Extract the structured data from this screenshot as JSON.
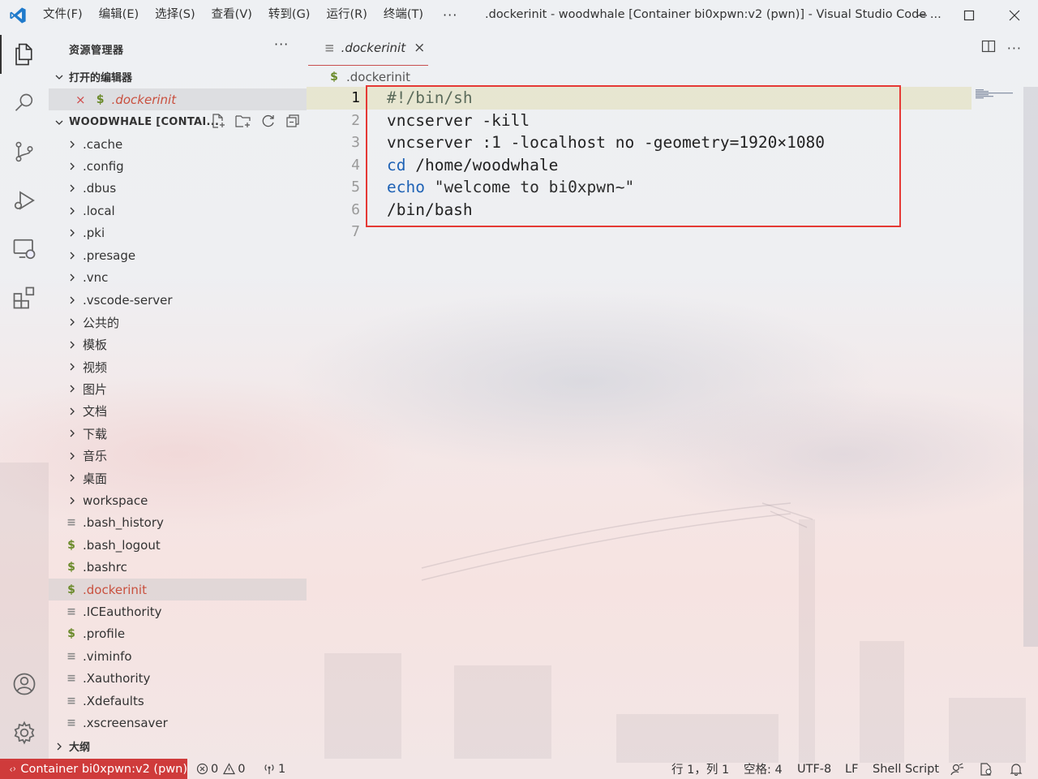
{
  "window": {
    "title": ".dockerinit - woodwhale [Container bi0xpwn:v2 (pwn)] - Visual Studio Code ...",
    "menu": [
      "文件(F)",
      "编辑(E)",
      "选择(S)",
      "查看(V)",
      "转到(G)",
      "运行(R)",
      "终端(T)"
    ],
    "menu_more": "···"
  },
  "activity_bar": {
    "items": [
      "files-icon",
      "search-icon",
      "source-control-icon",
      "run-debug-icon",
      "remote-explorer-icon",
      "extensions-icon"
    ],
    "bottom": [
      "account-icon",
      "settings-gear-icon"
    ]
  },
  "explorer": {
    "title": "资源管理器",
    "more": "···",
    "open_editors": {
      "header": "打开的编辑器",
      "items": [
        {
          "name": ".dockerinit",
          "icon": "$",
          "close": "×"
        }
      ]
    },
    "workspace": {
      "header": "WOODWHALE [CONTAI...",
      "folders": [
        ".cache",
        ".config",
        ".dbus",
        ".local",
        ".pki",
        ".presage",
        ".vnc",
        ".vscode-server",
        "公共的",
        "模板",
        "视频",
        "图片",
        "文档",
        "下载",
        "音乐",
        "桌面",
        "workspace"
      ],
      "files": [
        {
          "name": ".bash_history",
          "icon": "≡"
        },
        {
          "name": ".bash_logout",
          "icon": "$"
        },
        {
          "name": ".bashrc",
          "icon": "$"
        },
        {
          "name": ".dockerinit",
          "icon": "$"
        },
        {
          "name": ".ICEauthority",
          "icon": "≡"
        },
        {
          "name": ".profile",
          "icon": "$"
        },
        {
          "name": ".viminfo",
          "icon": "≡"
        },
        {
          "name": ".Xauthority",
          "icon": "≡"
        },
        {
          "name": ".Xdefaults",
          "icon": "≡"
        },
        {
          "name": ".xscreensaver",
          "icon": "≡"
        }
      ]
    },
    "outline_header": "大纲"
  },
  "editor": {
    "tab_label": ".dockerinit",
    "tab_icon": "≡",
    "tab_close": "×",
    "breadcrumb": ".dockerinit",
    "breadcrumb_icon": "$",
    "lines": [
      {
        "n": "1",
        "text": "#!/bin/sh"
      },
      {
        "n": "2",
        "text": "vncserver -kill"
      },
      {
        "n": "3",
        "text": "vncserver :1 -localhost no -geometry=1920×1080"
      },
      {
        "n": "4",
        "kw": "cd",
        "text": " /home/woodwhale"
      },
      {
        "n": "5",
        "kw": "echo",
        "text": " \"welcome to bi0xpwn~\""
      },
      {
        "n": "6",
        "text": "/bin/bash"
      },
      {
        "n": "7",
        "text": ""
      }
    ]
  },
  "status": {
    "remote": "Container bi0xpwn:v2 (pwn)",
    "errors": "0",
    "warnings": "0",
    "ports": "1",
    "position": "行 1，列 1",
    "spaces": "空格: 4",
    "encoding": "UTF-8",
    "eol": "LF",
    "language": "Shell Script"
  }
}
